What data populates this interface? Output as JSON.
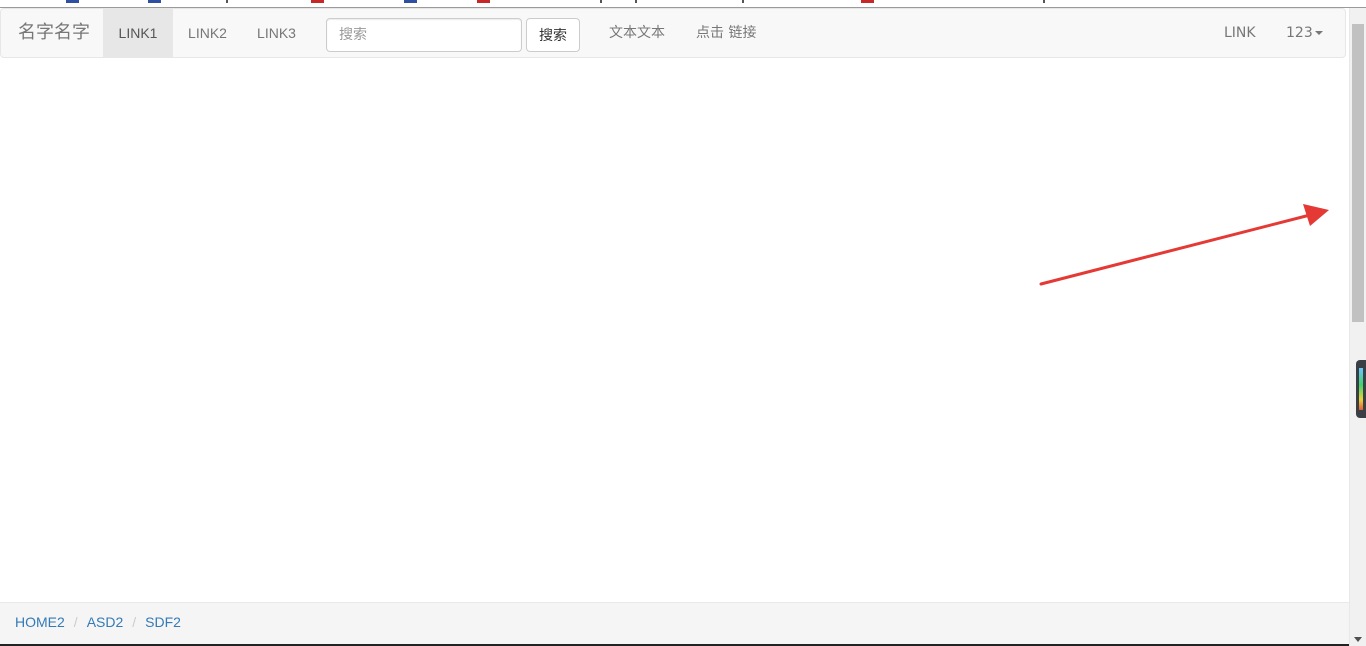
{
  "navbar": {
    "brand": "名字名字",
    "links": [
      {
        "label": "LINK1",
        "active": true
      },
      {
        "label": "LINK2",
        "active": false
      },
      {
        "label": "LINK3",
        "active": false
      }
    ],
    "search": {
      "placeholder": "搜索",
      "value": "",
      "button_label": "搜索"
    },
    "text_item": "文本文本",
    "click_link": "点击 链接",
    "right_link": "LINK",
    "dropdown_label": "123"
  },
  "breadcrumb": {
    "items": [
      "HOME2",
      "ASD2",
      "SDF2"
    ],
    "separator": "/"
  },
  "colors": {
    "navbar_bg": "#f8f8f8",
    "active_link_bg": "#e7e7e7",
    "link_blue": "#337ab7",
    "annotation_arrow": "#e53935"
  }
}
